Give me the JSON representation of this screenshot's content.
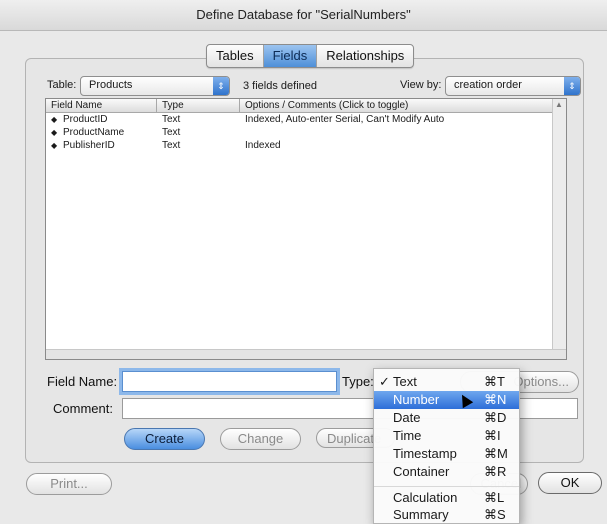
{
  "window": {
    "title": "Define Database for \"SerialNumbers\""
  },
  "tabs": [
    {
      "label": "Tables",
      "active": false
    },
    {
      "label": "Fields",
      "active": true
    },
    {
      "label": "Relationships",
      "active": false
    }
  ],
  "table_selector": {
    "label": "Table:",
    "value": "Products"
  },
  "fields_count": "3 fields defined",
  "view_by": {
    "label": "View by:",
    "value": "creation order"
  },
  "field_list": {
    "columns": [
      "Field Name",
      "Type",
      "Options / Comments   (Click to toggle)"
    ],
    "rows": [
      {
        "name": "ProductID",
        "type": "Text",
        "options": "Indexed, Auto-enter Serial, Can't Modify Auto"
      },
      {
        "name": "ProductName",
        "type": "Text",
        "options": ""
      },
      {
        "name": "PublisherID",
        "type": "Text",
        "options": "Indexed"
      }
    ]
  },
  "form": {
    "field_name_label": "Field Name:",
    "field_name_value": "",
    "type_label": "Type:",
    "comment_label": "Comment:",
    "comment_value": "",
    "options_button": "Options..."
  },
  "buttons": {
    "create": "Create",
    "change": "Change",
    "duplicate": "Duplicate",
    "print": "Print...",
    "cancel": "Cancel",
    "ok": "OK"
  },
  "type_menu": {
    "items": [
      {
        "check": "✓",
        "name": "Text",
        "key": "⌘T",
        "highlighted": false
      },
      {
        "check": "",
        "name": "Number",
        "key": "⌘N",
        "highlighted": true
      },
      {
        "check": "",
        "name": "Date",
        "key": "⌘D",
        "highlighted": false
      },
      {
        "check": "",
        "name": "Time",
        "key": "⌘I",
        "highlighted": false
      },
      {
        "check": "",
        "name": "Timestamp",
        "key": "⌘M",
        "highlighted": false
      },
      {
        "check": "",
        "name": "Container",
        "key": "⌘R",
        "highlighted": false
      },
      {
        "check": "",
        "name": "Calculation",
        "key": "⌘L",
        "highlighted": false
      },
      {
        "check": "",
        "name": "Summary",
        "key": "⌘S",
        "highlighted": false
      }
    ]
  }
}
